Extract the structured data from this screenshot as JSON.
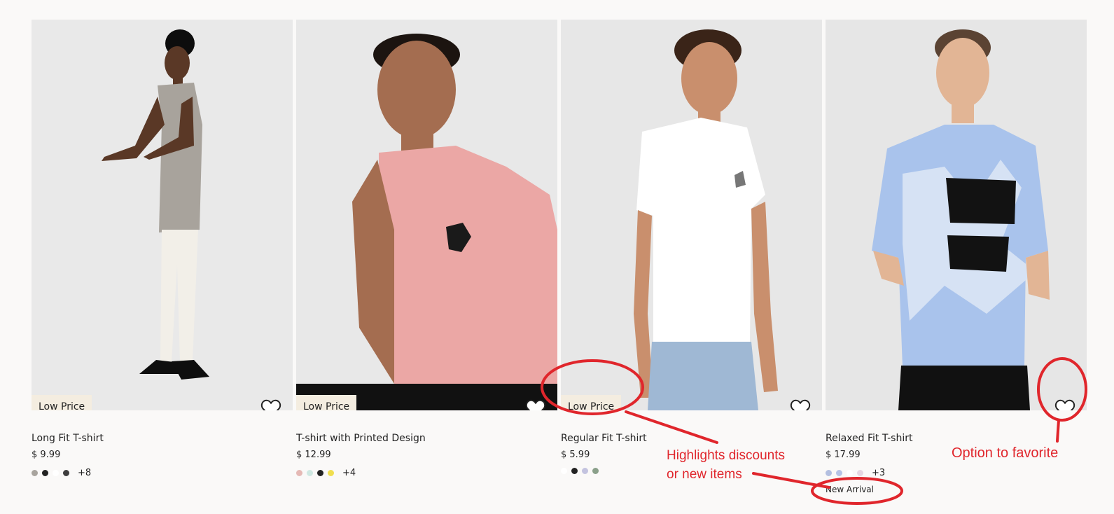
{
  "products": [
    {
      "name": "Long Fit T-shirt",
      "price": "$ 9.99",
      "badge": "Low Price",
      "tag": "",
      "more_colors": "+8",
      "swatches": [
        "#a8a49e",
        "#222222",
        "#ffffff",
        "#3d3d3d"
      ],
      "background": "#e9e9e9"
    },
    {
      "name": "T-shirt with Printed Design",
      "price": "$ 12.99",
      "badge": "Low Price",
      "tag": "",
      "more_colors": "+4",
      "swatches": [
        "#e5b9b5",
        "#cfe8e2",
        "#222222",
        "#f0de4f"
      ],
      "background": "#e8e8e8"
    },
    {
      "name": "Regular Fit T-shirt",
      "price": "$ 5.99",
      "badge": "Low Price",
      "tag": "",
      "more_colors": "",
      "swatches": [
        "#ffffff",
        "#222222",
        "#c3c3df",
        "#8aa08a"
      ],
      "background": "#e7e7e7"
    },
    {
      "name": "Relaxed Fit T-shirt",
      "price": "$ 17.99",
      "badge": "",
      "tag": "New Arrival",
      "more_colors": "+3",
      "swatches": [
        "#b3bfe0",
        "#b6c3e6",
        "#ffffff",
        "#e5d6e2"
      ],
      "background": "#e6e6e6"
    }
  ],
  "annotations": {
    "highlights": [
      "Highlights discounts",
      "or new items"
    ],
    "favorite": "Option to favorite",
    "color": "#e0262c"
  }
}
